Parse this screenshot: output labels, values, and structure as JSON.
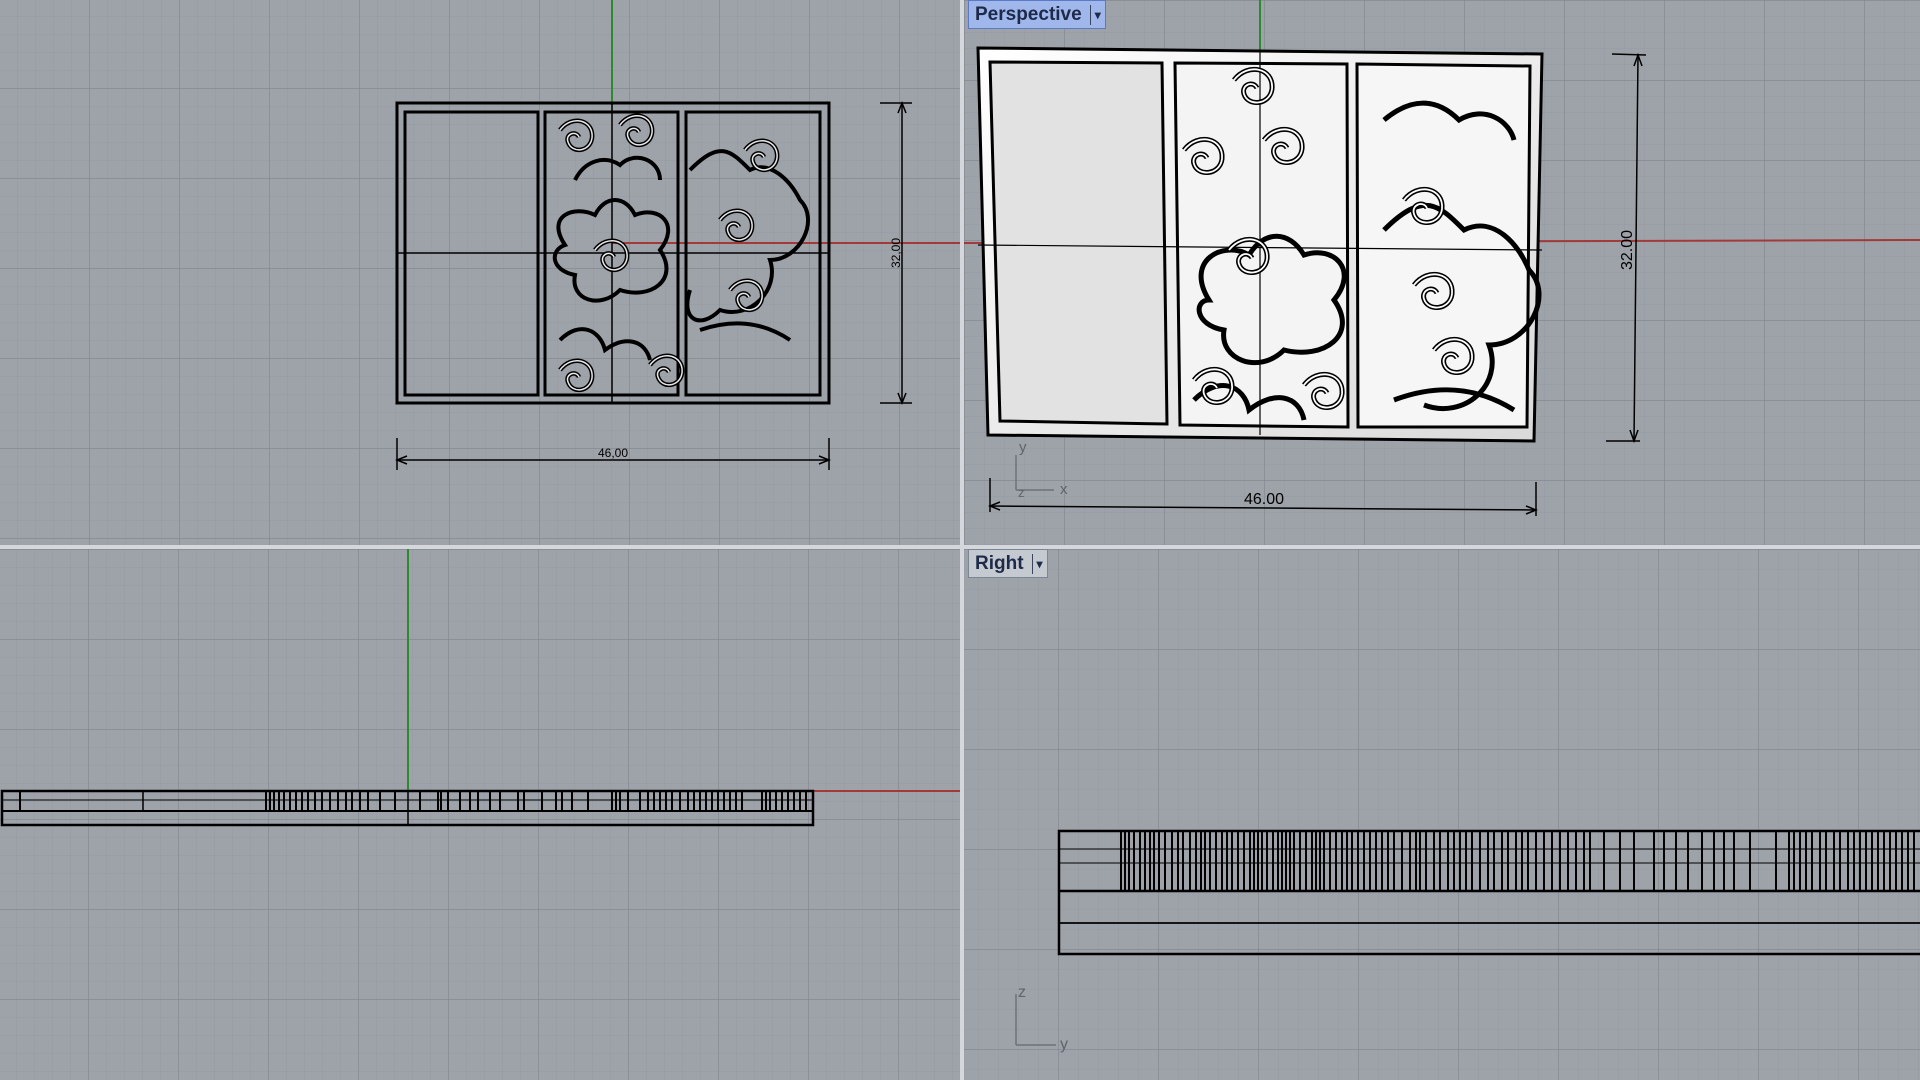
{
  "viewports": {
    "top": {
      "dim_width": "46,00",
      "dim_height": "32,00"
    },
    "perspective": {
      "label": "Perspective",
      "dim_width": "46.00",
      "dim_height": "32.00"
    },
    "right": {
      "label": "Right"
    },
    "front": {}
  },
  "axis_labels": {
    "x": "x",
    "y": "y",
    "z": "z"
  },
  "icons": {
    "dropdown": "chevron-down-icon"
  },
  "colors": {
    "viewport_bg": "#9ea3aa",
    "grid_minor": "#959aa2",
    "grid_major": "#7f848c",
    "x_axis": "#a33a3a",
    "y_axis": "#2e8a2e",
    "active_tab": "#9fb7ea",
    "geometry": "#000000"
  }
}
